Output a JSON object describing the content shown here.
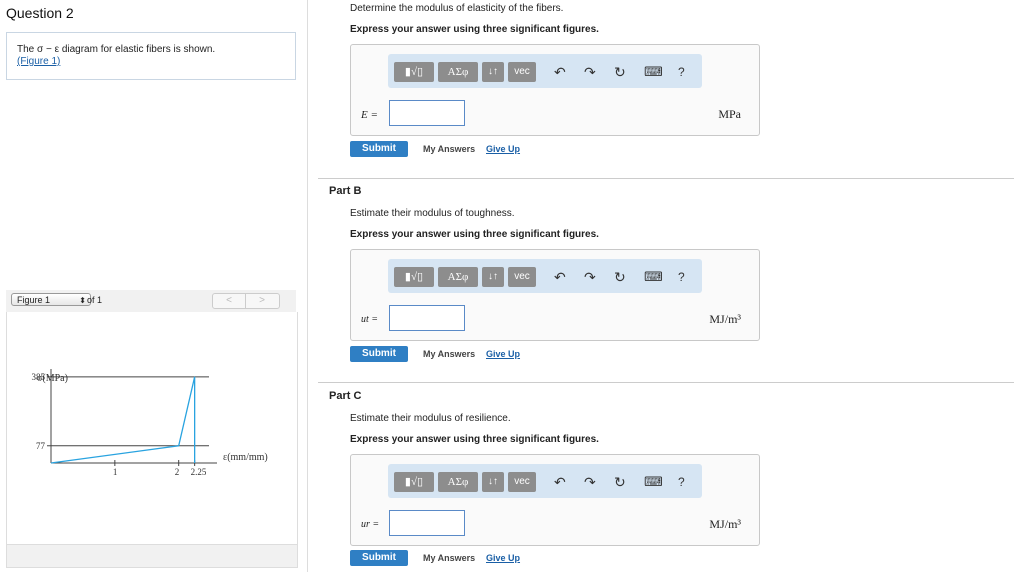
{
  "question": {
    "title": "Question 2",
    "intro_text": "The σ − ε diagram for elastic fibers is shown.",
    "figure_link": "(Figure 1)"
  },
  "figure": {
    "selector": "Figure 1",
    "of_label": "of 1",
    "prev": "<",
    "next": ">",
    "chart_data": {
      "type": "line",
      "xlabel": "ε(mm/mm)",
      "ylabel": "σ(MPa)",
      "x_ticks": [
        "1",
        "2",
        "2.25"
      ],
      "y_ticks": [
        "77",
        "385"
      ],
      "series": [
        {
          "x": [
            0,
            2,
            2.25,
            2.25
          ],
          "y": [
            0,
            77,
            385,
            0
          ]
        }
      ],
      "xlim": [
        0,
        2.6
      ],
      "ylim": [
        0,
        420
      ]
    }
  },
  "partA": {
    "prompt": "Determine the modulus of elasticity of the fibers.",
    "instruction": "Express your answer using three significant figures.",
    "label": "E =",
    "unit": "MPa",
    "value": ""
  },
  "partB": {
    "heading": "Part B",
    "prompt": "Estimate their modulus of toughness.",
    "instruction": "Express your answer using three significant figures.",
    "label": "ut =",
    "unit": "MJ/m³",
    "value": ""
  },
  "partC": {
    "heading": "Part C",
    "prompt": "Estimate their modulus of resilience.",
    "instruction": "Express your answer using three significant figures.",
    "label": "ur =",
    "unit": "MJ/m³",
    "value": ""
  },
  "toolbar": {
    "templates": "▮√▯",
    "greek": "ΑΣφ",
    "arrows": "↓↑",
    "vec": "vec",
    "undo": "↶",
    "redo": "↷",
    "reset": "↻",
    "keyboard": "⌨",
    "help": "?"
  },
  "actions": {
    "submit": "Submit",
    "my_answers": "My Answers",
    "give_up": "Give Up"
  },
  "colors": {
    "accent": "#2f7fc4",
    "toolbar_bg": "#d6e5f3",
    "line": "#29a3e0"
  }
}
